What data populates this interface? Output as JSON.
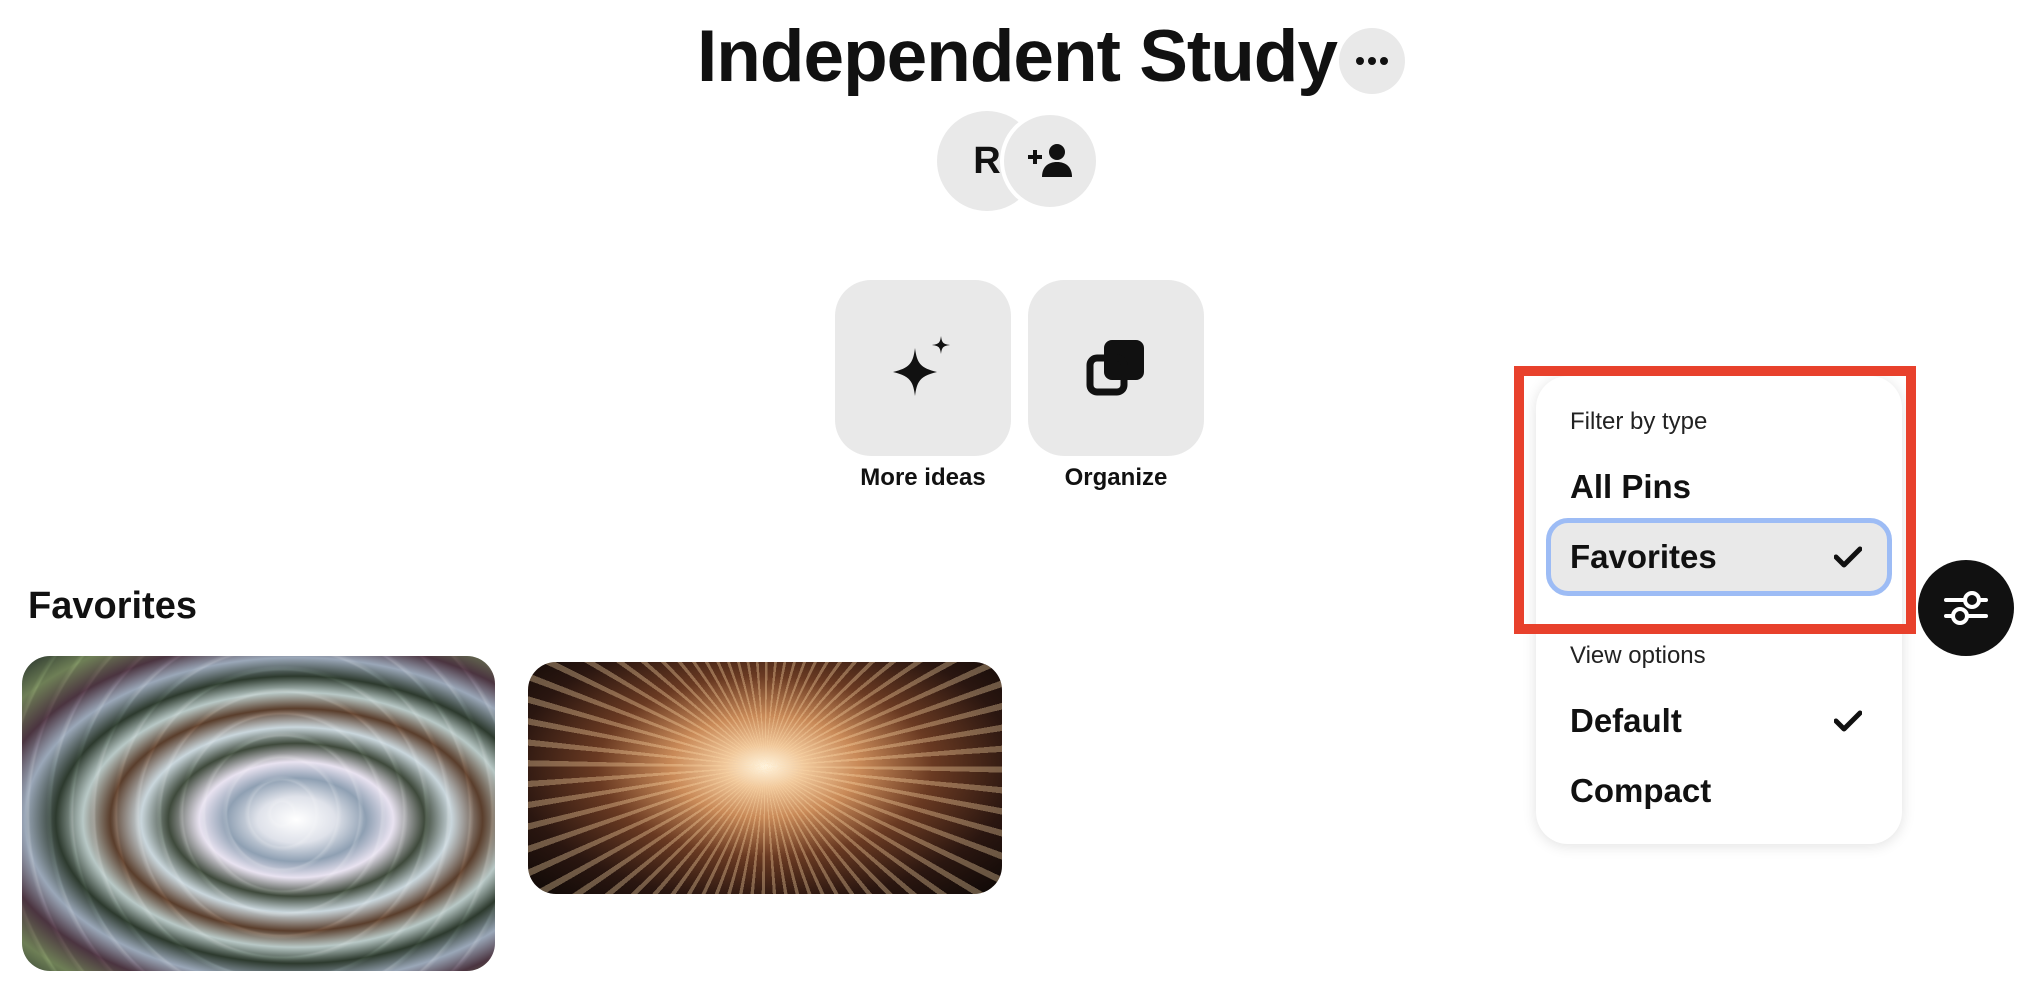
{
  "board": {
    "title": "Independent Study",
    "owner_initial": "R"
  },
  "actions": [
    {
      "label": "More ideas",
      "icon": "sparkle-icon"
    },
    {
      "label": "Organize",
      "icon": "organize-icon"
    }
  ],
  "section": {
    "title": "Favorites",
    "pins": [
      {
        "icon": "swirl-image"
      },
      {
        "icon": "city-lights-image"
      }
    ]
  },
  "menu": {
    "filter_heading": "Filter by type",
    "filter_items": [
      {
        "label": "All Pins",
        "checked": false
      },
      {
        "label": "Favorites",
        "checked": true
      }
    ],
    "view_heading": "View options",
    "view_items": [
      {
        "label": "Default",
        "checked": true
      },
      {
        "label": "Compact",
        "checked": false
      }
    ]
  },
  "colors": {
    "highlight": "#e8412c",
    "focus_ring": "#9dbcf5",
    "tile_bg": "#e9e9e9"
  }
}
